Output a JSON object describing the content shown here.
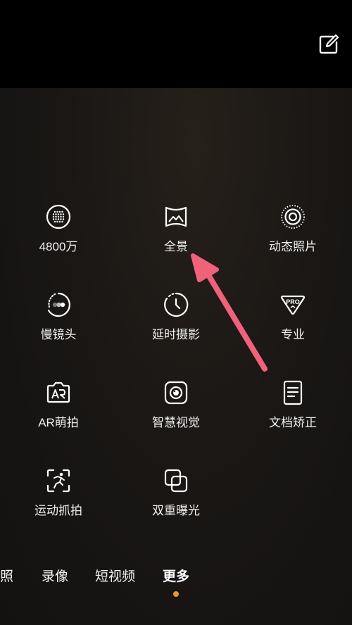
{
  "modes": [
    {
      "label": "4800万",
      "icon": "48mp-dots-icon"
    },
    {
      "label": "全景",
      "icon": "panorama-icon"
    },
    {
      "label": "动态照片",
      "icon": "live-photo-icon"
    },
    {
      "label": "慢镜头",
      "icon": "slow-motion-icon"
    },
    {
      "label": "延时摄影",
      "icon": "timelapse-clock-icon"
    },
    {
      "label": "专业",
      "icon": "pro-icon"
    },
    {
      "label": "AR萌拍",
      "icon": "ar-camera-icon"
    },
    {
      "label": "智慧视觉",
      "icon": "smart-vision-icon"
    },
    {
      "label": "文档矫正",
      "icon": "document-icon"
    },
    {
      "label": "运动抓拍",
      "icon": "sport-capture-icon"
    },
    {
      "label": "双重曝光",
      "icon": "double-exposure-icon"
    }
  ],
  "pro_badge": "PRO",
  "bottom_tabs": [
    {
      "label": "拍照",
      "visible_text": "照"
    },
    {
      "label": "录像"
    },
    {
      "label": "短视频"
    },
    {
      "label": "更多",
      "active": true
    }
  ],
  "colors": {
    "accent_dot": "#f5921e",
    "annotation_arrow": "#f0627a"
  },
  "icons": {
    "edit": "edit-icon"
  }
}
